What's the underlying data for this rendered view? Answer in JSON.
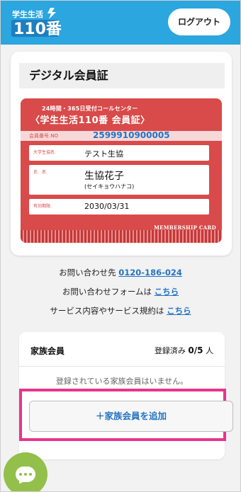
{
  "header": {
    "logo_top": "学生生活",
    "logo_main": "110番",
    "logout_label": "ログアウト"
  },
  "card": {
    "section_title": "デジタル会員証",
    "subtitle": "24時間・365日受付コールセンター",
    "title": "〈学生生活110番 会員証〉",
    "member_no_label": "会員番号.NO",
    "member_no": "2599910900005",
    "univ_label": "大学生協名.",
    "univ_value": "テスト生協",
    "name_label": "氏　名.",
    "name_value": "生協花子",
    "name_kana": "(セイキョウハナコ)",
    "expiry_label": "有効期限.",
    "expiry_value": "2030/03/31",
    "footer_tag": "MEMBERSHIP CARD"
  },
  "contact": {
    "phone_prefix": "お問い合わせ先",
    "phone": "0120-186-024",
    "form_prefix": "お問い合わせフォームは",
    "form_link": "こちら",
    "terms_prefix": "サービス内容やサービス規約は",
    "terms_link": "こちら"
  },
  "family": {
    "title": "家族会員",
    "registered_label": "登録済み",
    "count": "0/5",
    "unit": "人",
    "empty_message": "登録されている家族会員はいません。",
    "add_button": "＋家族会員を追加"
  },
  "colors": {
    "header": "#2ba6df",
    "card": "#d94a4a",
    "link": "#2573c4",
    "highlight": "#e8348f",
    "chat": "#92c04a"
  },
  "icons": {
    "logo": "gakusei-seikatsu-110ban-logo",
    "chat": "chat-bubble-icon"
  }
}
